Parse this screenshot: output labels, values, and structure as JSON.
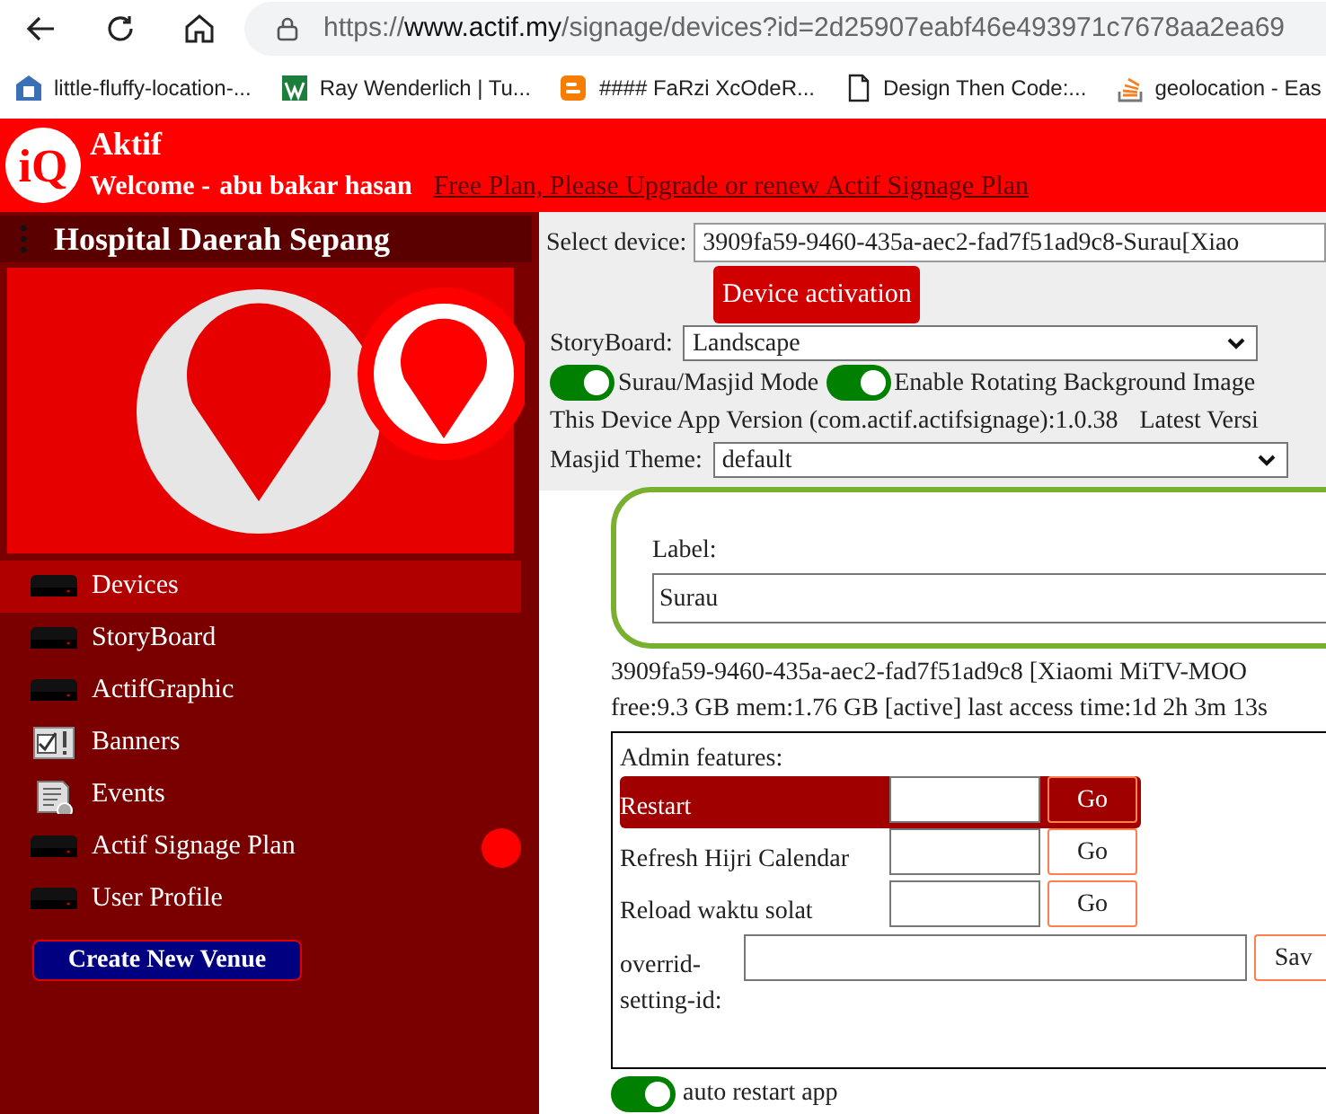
{
  "browser": {
    "url_prefix": "https://",
    "url_host": "www.actif.my",
    "url_path": "/signage/devices?id=2d25907eabf46e493971c7678aa2ea69",
    "bookmarks": [
      {
        "label": "little-fluffy-location-...",
        "kind": "p"
      },
      {
        "label": "Ray Wenderlich | Tu...",
        "kind": "rw"
      },
      {
        "label": "#### FaRzi XcOdeR...",
        "kind": "blogger"
      },
      {
        "label": "Design Then Code:...",
        "kind": "page"
      },
      {
        "label": "geolocation - Eas",
        "kind": "stack"
      }
    ]
  },
  "header": {
    "logo": "iQ",
    "title": "Aktif",
    "welcome": "Welcome -",
    "user": "abu bakar hasan",
    "plan_link": "Free Plan, Please Upgrade or renew Actif Signage Plan"
  },
  "sidebar": {
    "venue": "Hospital Daerah Sepang",
    "items": [
      {
        "label": "Devices",
        "kind": "drive",
        "selected": true,
        "badge": false
      },
      {
        "label": "StoryBoard",
        "kind": "drive",
        "selected": false,
        "badge": false
      },
      {
        "label": "ActifGraphic",
        "kind": "drive",
        "selected": false,
        "badge": false
      },
      {
        "label": "Banners",
        "kind": "checklist",
        "selected": false,
        "badge": false
      },
      {
        "label": "Events",
        "kind": "document",
        "selected": false,
        "badge": false
      },
      {
        "label": "Actif Signage Plan",
        "kind": "drive",
        "selected": false,
        "badge": true
      },
      {
        "label": "User Profile",
        "kind": "drive",
        "selected": false,
        "badge": false
      }
    ],
    "create_button": "Create New Venue"
  },
  "device": {
    "select_label": "Select device:",
    "select_value": "3909fa59-9460-435a-aec2-fad7f51ad9c8-Surau[Xiao",
    "activation_button": "Device activation",
    "storyboard_label": "StoryBoard:",
    "storyboard_value": "Landscape",
    "toggles": [
      {
        "label": "Surau/Masjid Mode",
        "on": true
      },
      {
        "label": "Enable Rotating Background Image",
        "on": true
      }
    ],
    "version": "This Device App Version (com.actif.actifsignage):1.0.38",
    "latest": "Latest Versi",
    "theme_label": "Masjid Theme:",
    "theme_value": "default",
    "label_caption": "Label:",
    "label_value": "Surau",
    "info_line_1": "3909fa59-9460-435a-aec2-fad7f51ad9c8 [Xiaomi MiTV-MOO",
    "info_line_2": "free:9.3 GB mem:1.76 GB [active] last access time:1d 2h 3m 13s",
    "admin": {
      "title": "Admin features:",
      "rows": [
        {
          "label": "Restart",
          "button": "Go",
          "selected": true
        },
        {
          "label": "Refresh Hijri Calendar",
          "button": "Go",
          "selected": false
        },
        {
          "label": "Reload waktu solat",
          "button": "Go",
          "selected": false
        }
      ],
      "override_label": "overrid-setting-id:",
      "override_button": "Sav"
    },
    "bottom_toggles": [
      {
        "label": "auto restart app",
        "on": true
      }
    ]
  }
}
